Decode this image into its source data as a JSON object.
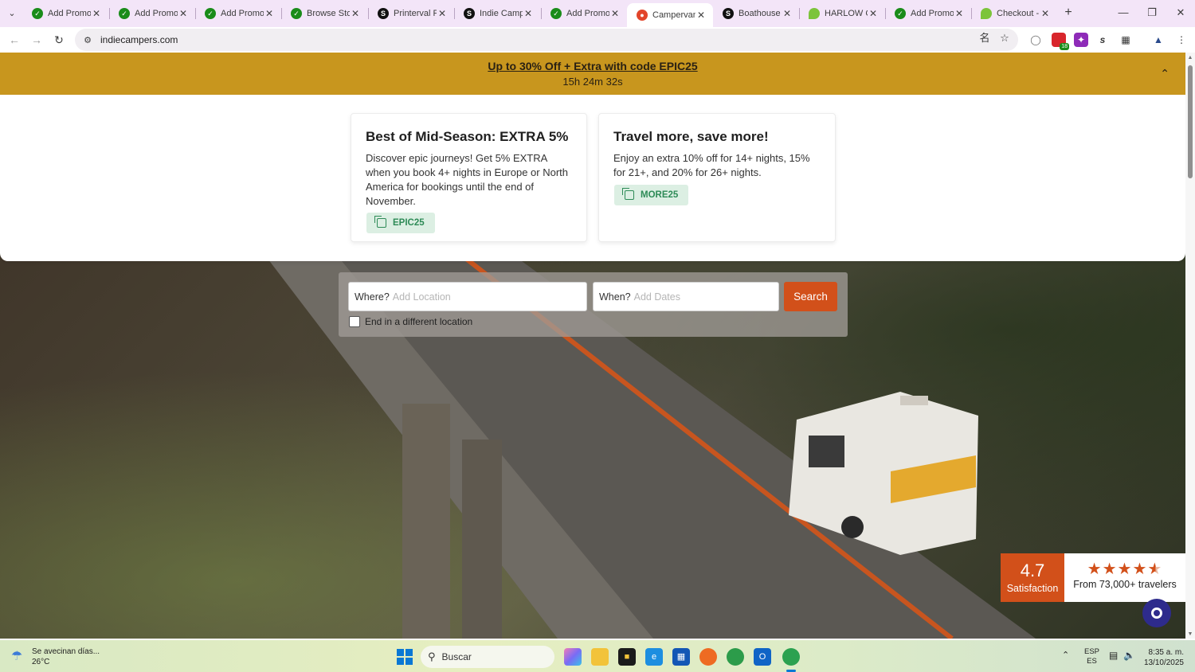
{
  "browser": {
    "tabs": [
      {
        "title": "Add Promo C",
        "favicon": "green",
        "active": false
      },
      {
        "title": "Add Promo C",
        "favicon": "green",
        "active": false
      },
      {
        "title": "Add Promo C",
        "favicon": "green",
        "active": false
      },
      {
        "title": "Browse Store",
        "favicon": "green",
        "active": false
      },
      {
        "title": "Printerval Pr",
        "favicon": "black",
        "active": false
      },
      {
        "title": "Indie Campe",
        "favicon": "black",
        "active": false
      },
      {
        "title": "Add Promo C",
        "favicon": "green",
        "active": false
      },
      {
        "title": "Campervan",
        "favicon": "red",
        "active": true
      },
      {
        "title": "Boathouse P",
        "favicon": "black",
        "active": false
      },
      {
        "title": "HARLOW CU",
        "favicon": "lime",
        "active": false
      },
      {
        "title": "Add Promo C",
        "favicon": "green",
        "active": false
      },
      {
        "title": "Checkout - E",
        "favicon": "lime",
        "active": false
      }
    ],
    "url": "indiecampers.com",
    "extension_badge": "18"
  },
  "promo_bar": {
    "link_text": "Up to 30% Off + Extra with code EPIC25",
    "countdown": "15h 24m 32s"
  },
  "offers": [
    {
      "title": "Best of Mid-Season: EXTRA 5%",
      "description": "Discover epic journeys! Get 5% EXTRA when you book 4+ nights in Europe or North America for bookings until the end of November.",
      "code": "EPIC25"
    },
    {
      "title": "Travel more, save more!",
      "description": "Enjoy an extra 10% off for 14+ nights, 15% for 21+, and 20% for 26+ nights.",
      "code": "MORE25"
    }
  ],
  "search": {
    "where_label": "Where?",
    "where_placeholder": "Add Location",
    "when_label": "When?",
    "when_placeholder": "Add Dates",
    "button": "Search",
    "checkbox_label": "End in a different location"
  },
  "rating": {
    "score": "4.7",
    "caption": "Satisfaction",
    "travelers": "From 73,000+ travelers",
    "stars": 4.5
  },
  "taskbar": {
    "weather_line1": "Se avecinan días...",
    "weather_line2": "26°C",
    "search_placeholder": "Buscar",
    "lang_line1": "ESP",
    "lang_line2": "ES",
    "time": "8:35 a. m.",
    "date": "13/10/2025"
  },
  "colors": {
    "promo_bar": "#c8961e",
    "accent_orange": "#d2501a",
    "code_green": "#2e8b57",
    "chat": "#2e2b8c"
  }
}
